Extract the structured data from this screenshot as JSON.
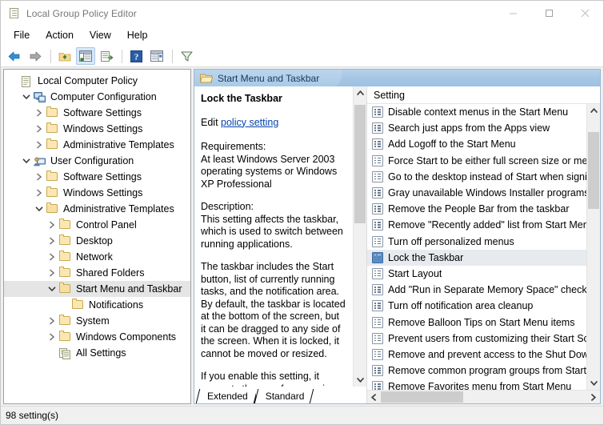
{
  "window": {
    "title": "Local Group Policy Editor",
    "title_icon": "policy-document-icon",
    "minimize_label": "–",
    "maximize_label": "□",
    "close_label": "✕"
  },
  "menubar": {
    "items": [
      {
        "label": "File"
      },
      {
        "label": "Action"
      },
      {
        "label": "View"
      },
      {
        "label": "Help"
      }
    ]
  },
  "toolbar": {
    "items": [
      {
        "name": "back-icon"
      },
      {
        "name": "forward-icon"
      },
      {
        "name": "up-folder-icon"
      },
      {
        "name": "show-hide-console-tree-icon"
      },
      {
        "name": "export-list-icon"
      },
      {
        "name": "help-icon"
      },
      {
        "name": "show-hide-action-pane-icon"
      },
      {
        "name": "filter-icon"
      }
    ]
  },
  "tree": {
    "items": [
      {
        "label": "Local Computer Policy",
        "indent": 0,
        "twisty": "none",
        "icon": "policy-document-icon",
        "selected": false
      },
      {
        "label": "Computer Configuration",
        "indent": 1,
        "twisty": "expanded",
        "icon": "computer-icon",
        "selected": false
      },
      {
        "label": "Software Settings",
        "indent": 2,
        "twisty": "collapsed",
        "icon": "folder-icon",
        "selected": false
      },
      {
        "label": "Windows Settings",
        "indent": 2,
        "twisty": "collapsed",
        "icon": "folder-icon",
        "selected": false
      },
      {
        "label": "Administrative Templates",
        "indent": 2,
        "twisty": "collapsed",
        "icon": "folder-icon",
        "selected": false
      },
      {
        "label": "User Configuration",
        "indent": 1,
        "twisty": "expanded",
        "icon": "user-icon",
        "selected": false
      },
      {
        "label": "Software Settings",
        "indent": 2,
        "twisty": "collapsed",
        "icon": "folder-icon",
        "selected": false
      },
      {
        "label": "Windows Settings",
        "indent": 2,
        "twisty": "collapsed",
        "icon": "folder-icon",
        "selected": false
      },
      {
        "label": "Administrative Templates",
        "indent": 2,
        "twisty": "expanded",
        "icon": "folder-open-icon",
        "selected": false
      },
      {
        "label": "Control Panel",
        "indent": 3,
        "twisty": "collapsed",
        "icon": "folder-icon",
        "selected": false
      },
      {
        "label": "Desktop",
        "indent": 3,
        "twisty": "collapsed",
        "icon": "folder-icon",
        "selected": false
      },
      {
        "label": "Network",
        "indent": 3,
        "twisty": "collapsed",
        "icon": "folder-icon",
        "selected": false
      },
      {
        "label": "Shared Folders",
        "indent": 3,
        "twisty": "collapsed",
        "icon": "folder-icon",
        "selected": false
      },
      {
        "label": "Start Menu and Taskbar",
        "indent": 3,
        "twisty": "expanded",
        "icon": "folder-open-icon",
        "selected": true
      },
      {
        "label": "Notifications",
        "indent": 4,
        "twisty": "none",
        "icon": "folder-icon",
        "selected": false
      },
      {
        "label": "System",
        "indent": 3,
        "twisty": "collapsed",
        "icon": "folder-icon",
        "selected": false
      },
      {
        "label": "Windows Components",
        "indent": 3,
        "twisty": "collapsed",
        "icon": "folder-icon",
        "selected": false
      },
      {
        "label": "All Settings",
        "indent": 3,
        "twisty": "none",
        "icon": "all-settings-icon",
        "selected": false
      }
    ]
  },
  "pane_header": {
    "title": "Start Menu and Taskbar",
    "icon": "folder-open-icon"
  },
  "detail": {
    "title": "Lock the Taskbar",
    "edit_prefix": "Edit ",
    "edit_link": "policy setting",
    "requirements_label": "Requirements:",
    "requirements_text": "At least Windows Server 2003 operating systems or Windows XP Professional",
    "description_label": "Description:",
    "description_p1": "This setting affects the taskbar, which is used to switch between running applications.",
    "description_p2": "The taskbar includes the Start button, list of currently running tasks, and the notification area. By default, the taskbar is located at the bottom of the screen, but it can be dragged to any side of the screen. When it is locked, it cannot be moved or resized.",
    "description_p3": "If you enable this setting, it prevents the user from moving or",
    "tabs": [
      {
        "label": "Extended",
        "active": true
      },
      {
        "label": "Standard",
        "active": false
      }
    ]
  },
  "list": {
    "column_header": "Setting",
    "rows": [
      {
        "label": "Disable context menus in the Start Menu",
        "selected": false
      },
      {
        "label": "Search just apps from the Apps view",
        "selected": false
      },
      {
        "label": "Add Logoff to the Start Menu",
        "selected": false
      },
      {
        "label": "Force Start to be either full screen size or menu s",
        "selected": false
      },
      {
        "label": "Go to the desktop instead of Start when signing i",
        "selected": false
      },
      {
        "label": "Gray unavailable Windows Installer programs Sta",
        "selected": false
      },
      {
        "label": "Remove the People Bar from the taskbar",
        "selected": false
      },
      {
        "label": "Remove \"Recently added\" list from Start Menu",
        "selected": false
      },
      {
        "label": "Turn off personalized menus",
        "selected": false
      },
      {
        "label": "Lock the Taskbar",
        "selected": true
      },
      {
        "label": "Start Layout",
        "selected": false
      },
      {
        "label": "Add \"Run in Separate Memory Space\" check box",
        "selected": false
      },
      {
        "label": "Turn off notification area cleanup",
        "selected": false
      },
      {
        "label": "Remove Balloon Tips on Start Menu items",
        "selected": false
      },
      {
        "label": "Prevent users from customizing their Start Screen",
        "selected": false
      },
      {
        "label": "Remove and prevent access to the Shut Down, R",
        "selected": false
      },
      {
        "label": "Remove common program groups from Start M",
        "selected": false
      },
      {
        "label": "Remove Favorites menu from Start Menu",
        "selected": false
      }
    ]
  },
  "statusbar": {
    "text": "98 setting(s)"
  },
  "colors": {
    "header_band": "#a6c6e4",
    "selection": "#e7ebef",
    "tree_selection": "#e5e5e5",
    "link": "#0645ad",
    "title_text": "#767676"
  }
}
